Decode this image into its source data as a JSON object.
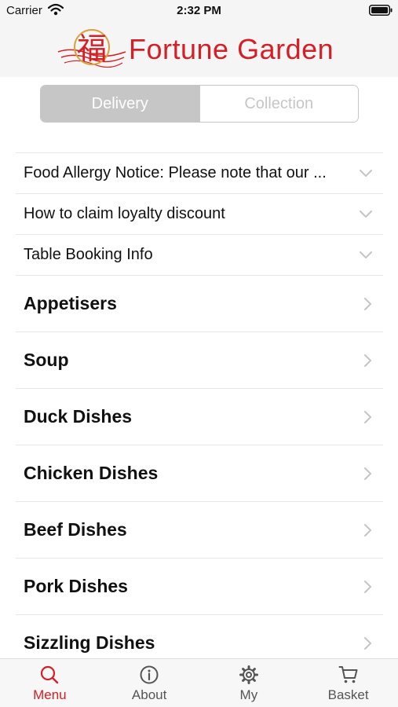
{
  "status_bar": {
    "carrier": "Carrier",
    "time": "2:32 PM"
  },
  "brand": {
    "name": "Fortune Garden",
    "logo_glyph": "福",
    "accent_color": "#d32027"
  },
  "order_type": {
    "delivery": "Delivery",
    "collection": "Collection",
    "selected": "Delivery"
  },
  "info_rows": [
    {
      "label": "Food Allergy Notice: Please note that our ...",
      "icon": "chevron-down-icon"
    },
    {
      "label": "How to claim loyalty discount",
      "icon": "chevron-down-icon"
    },
    {
      "label": "Table Booking Info",
      "icon": "chevron-down-icon"
    }
  ],
  "categories": [
    {
      "label": "Appetisers",
      "icon": "chevron-right-icon"
    },
    {
      "label": "Soup",
      "icon": "chevron-right-icon"
    },
    {
      "label": "Duck Dishes",
      "icon": "chevron-right-icon"
    },
    {
      "label": "Chicken Dishes",
      "icon": "chevron-right-icon"
    },
    {
      "label": "Beef Dishes",
      "icon": "chevron-right-icon"
    },
    {
      "label": "Pork Dishes",
      "icon": "chevron-right-icon"
    },
    {
      "label": "Sizzling Dishes",
      "icon": "chevron-right-icon"
    }
  ],
  "tab_bar": {
    "active": "Menu",
    "tabs": [
      {
        "label": "Menu",
        "icon": "search-icon"
      },
      {
        "label": "About",
        "icon": "info-icon"
      },
      {
        "label": "My",
        "icon": "gear-icon"
      },
      {
        "label": "Basket",
        "icon": "cart-icon"
      }
    ]
  }
}
